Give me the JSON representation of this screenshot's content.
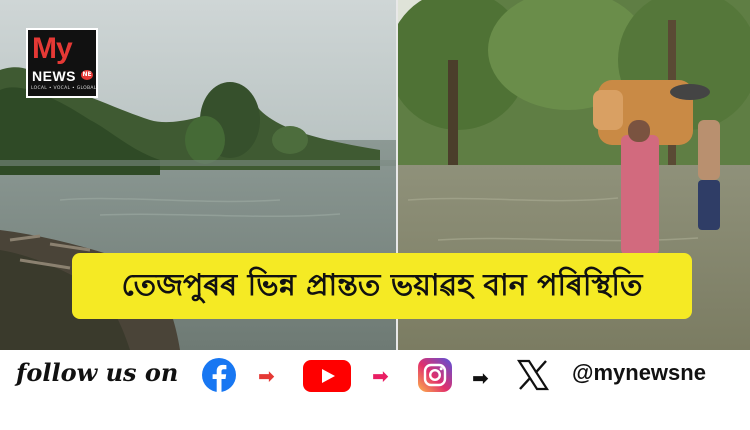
{
  "logo": {
    "name": "My NEWS NE",
    "line_my": "My",
    "line_news": "NEWS",
    "badge": "NE",
    "tagline": "LOCAL • VOCAL • GLOBAL"
  },
  "headline": "তেজপুৰৰ ভিন্ন প্ৰান্তত ভয়াৱহ বান পৰিস্থিতি",
  "social": {
    "follow_text": "follow us on",
    "icons": [
      "facebook-icon",
      "youtube-icon",
      "instagram-icon",
      "x-icon"
    ],
    "arrow_colors": [
      "#e53935",
      "#e91e63",
      "#111111"
    ],
    "handle": "@mynewsne"
  },
  "colors": {
    "banner": "#f5ea24",
    "facebook": "#1877f2",
    "youtube": "#ff0000",
    "instagram": "#d6249f",
    "brand_red": "#e53935"
  }
}
